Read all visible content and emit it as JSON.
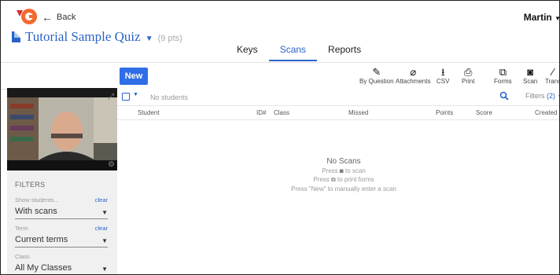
{
  "header": {
    "back_label": "Back",
    "user_name": "Martin",
    "quiz_title": "Tutorial Sample Quiz",
    "points": "(9 pts)"
  },
  "tabs": [
    {
      "label": "Keys"
    },
    {
      "label": "Scans",
      "active": true
    },
    {
      "label": "Reports"
    }
  ],
  "toolbar": {
    "new_label": "New",
    "tools": [
      {
        "label": "By Question",
        "icon": "pencil-icon"
      },
      {
        "label": "Attachments",
        "icon": "paperclip-icon"
      },
      {
        "label": "CSV",
        "icon": "download-icon"
      },
      {
        "label": "Print",
        "icon": "printer-icon"
      },
      {
        "label": "Forms",
        "icon": "forms-icon"
      },
      {
        "label": "Scan",
        "icon": "camera-icon"
      },
      {
        "label": "Trans",
        "icon": "wand-icon"
      }
    ]
  },
  "sidebar": {
    "filters_title": "FILTERS",
    "filters": [
      {
        "label": "Show students...",
        "value": "With scans",
        "clear": "clear"
      },
      {
        "label": "Term",
        "value": "Current terms",
        "clear": "clear"
      },
      {
        "label": "Class",
        "value": "All My Classes"
      }
    ]
  },
  "table": {
    "search_placeholder": "No students",
    "filters_label": "Filters",
    "filters_count": "(2)",
    "columns": [
      "Student",
      "ID#",
      "Class",
      "Missed",
      "Points",
      "Score",
      "Created"
    ]
  },
  "empty_state": {
    "title": "No Scans",
    "line1_prefix": "Press",
    "line1_suffix": "to scan",
    "line2_prefix": "Press",
    "line2_suffix": "to print forms",
    "line3": "Press \"New\" to manually enter a scan"
  },
  "colors": {
    "accent": "#2a63c8",
    "button": "#2f6ee8",
    "logo_orange": "#f26a2e"
  }
}
